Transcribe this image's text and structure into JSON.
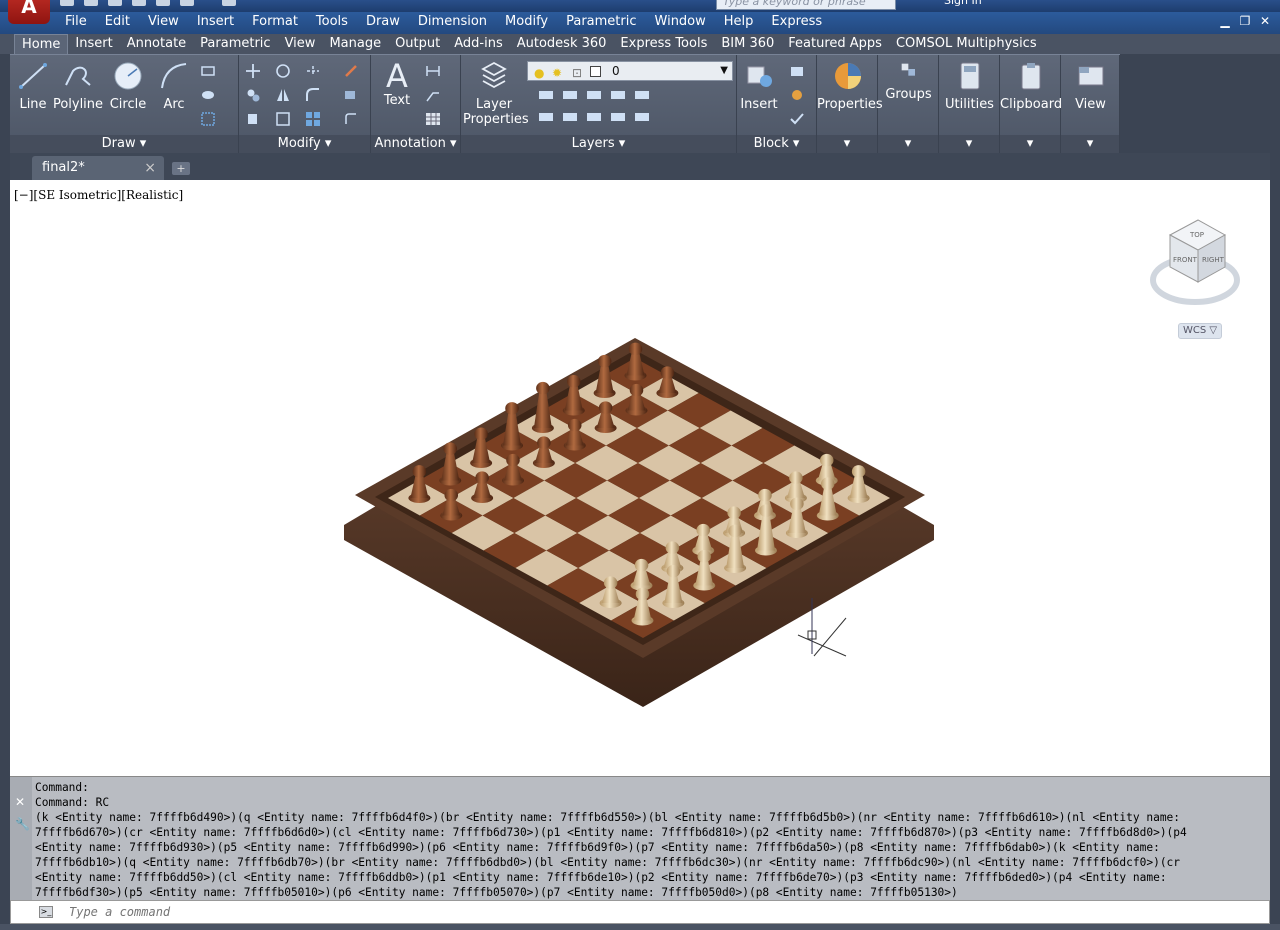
{
  "titlebar": {
    "search_placeholder": "Type a keyword or phrase",
    "signin": "Sign In",
    "logo": "A"
  },
  "menubar": [
    "File",
    "Edit",
    "View",
    "Insert",
    "Format",
    "Tools",
    "Draw",
    "Dimension",
    "Modify",
    "Parametric",
    "Window",
    "Help",
    "Express"
  ],
  "ribbon_tabs": [
    "Home",
    "Insert",
    "Annotate",
    "Parametric",
    "View",
    "Manage",
    "Output",
    "Add-ins",
    "Autodesk 360",
    "Express Tools",
    "BIM 360",
    "Featured Apps",
    "COMSOL Multiphysics"
  ],
  "ribbon": {
    "draw": {
      "title": "Draw",
      "line": "Line",
      "polyline": "Polyline",
      "circle": "Circle",
      "arc": "Arc"
    },
    "modify": {
      "title": "Modify"
    },
    "annotation": {
      "title": "Annotation",
      "text": "Text"
    },
    "layers": {
      "title": "Layers",
      "layer_props_1": "Layer",
      "layer_props_2": "Properties",
      "current_layer": "0"
    },
    "block": {
      "title": "Block",
      "insert": "Insert"
    },
    "properties": "Properties",
    "groups": "Groups",
    "utilities": "Utilities",
    "clipboard": "Clipboard",
    "view": "View"
  },
  "doc": {
    "tab": "final2*",
    "close": "×",
    "new_tab": "+"
  },
  "viewport": {
    "label": "[−][SE Isometric][Realistic]",
    "wcs": "WCS ▽",
    "cube_top": "TOP",
    "cube_front": "FRONT",
    "cube_right": "RIGHT"
  },
  "command": {
    "history": "Command:\nCommand: RC\n(k <Entity name: 7ffffb6d490>)(q <Entity name: 7ffffb6d4f0>)(br <Entity name: 7ffffb6d550>)(bl <Entity name: 7ffffb6d5b0>)(nr <Entity name: 7ffffb6d610>)(nl <Entity name:\n7ffffb6d670>)(cr <Entity name: 7ffffb6d6d0>)(cl <Entity name: 7ffffb6d730>)(p1 <Entity name: 7ffffb6d810>)(p2 <Entity name: 7ffffb6d870>)(p3 <Entity name: 7ffffb6d8d0>)(p4\n<Entity name: 7ffffb6d930>)(p5 <Entity name: 7ffffb6d990>)(p6 <Entity name: 7ffffb6d9f0>)(p7 <Entity name: 7ffffb6da50>)(p8 <Entity name: 7ffffb6dab0>)(k <Entity name:\n7ffffb6db10>)(q <Entity name: 7ffffb6db70>)(br <Entity name: 7ffffb6dbd0>)(bl <Entity name: 7ffffb6dc30>)(nr <Entity name: 7ffffb6dc90>)(nl <Entity name: 7ffffb6dcf0>)(cr\n<Entity name: 7ffffb6dd50>)(cl <Entity name: 7ffffb6ddb0>)(p1 <Entity name: 7ffffb6de10>)(p2 <Entity name: 7ffffb6de70>)(p3 <Entity name: 7ffffb6ded0>)(p4 <Entity name:\n7ffffb6df30>)(p5 <Entity name: 7ffffb05010>)(p6 <Entity name: 7ffffb05070>)(p7 <Entity name: 7ffffb050d0>)(p8 <Entity name: 7ffffb05130>)",
    "placeholder": "Type a command"
  },
  "colors": {
    "ribbon_bg": "#5f6879",
    "menubar": "#2c5b9c",
    "board_dark": "#7a3f22",
    "board_light": "#d9c4a6",
    "frame": "#4f3322",
    "dark_piece": "#8a5030",
    "light_piece": "#d8c09a"
  }
}
